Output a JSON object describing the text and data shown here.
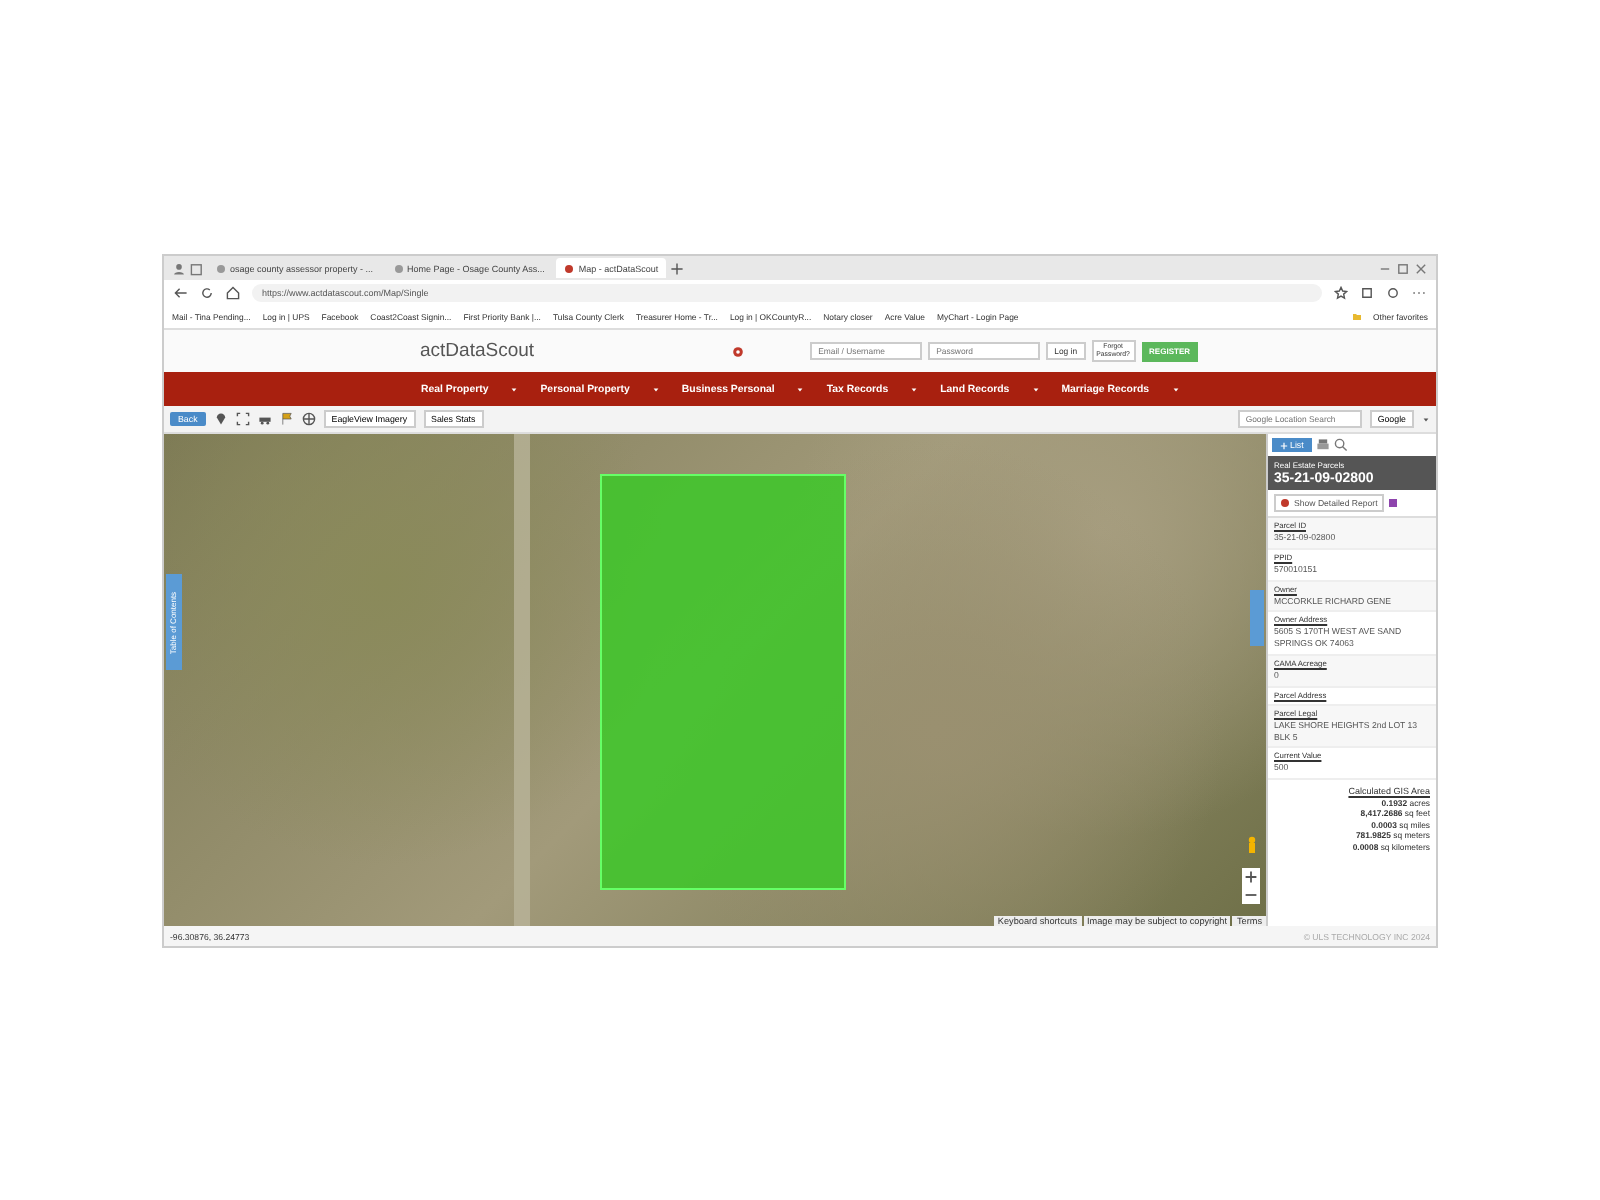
{
  "browser": {
    "tabs": [
      {
        "title": "osage county assessor property - ...",
        "selected": false
      },
      {
        "title": "Home Page - Osage County Ass...",
        "selected": false
      },
      {
        "title": "Map - actDataScout",
        "selected": true
      }
    ],
    "address": "https://www.actdatascout.com/Map/Single",
    "bookmarks": [
      "Mail - Tina Pending...",
      "Log in | UPS",
      "Facebook",
      "Coast2Coast Signin...",
      "First Priority Bank |...",
      "Tulsa County Clerk",
      "Treasurer Home - Tr...",
      "Log in | OKCountyR...",
      "Notary closer",
      "Acre Value",
      "MyChart - Login Page"
    ],
    "other_favorites": "Other favorites"
  },
  "site": {
    "logo": "actDataScout",
    "email_placeholder": "Email / Username",
    "password_placeholder": "Password",
    "login_button": "Log in",
    "forgot_link": "Forgot Password?",
    "register_button": "REGISTER",
    "nav": [
      "Real Property",
      "Personal Property",
      "Business Personal",
      "Tax Records",
      "Land Records",
      "Marriage Records"
    ]
  },
  "toolbar": {
    "back": "Back",
    "eagleview": "EagleView Imagery",
    "sales_stats": "Sales Stats",
    "search_placeholder": "Google Location Search",
    "provider": "Google"
  },
  "map": {
    "side_tab": "Table of Contents",
    "attribution": [
      "Keyboard shortcuts",
      "Image may be subject to copyright",
      "Terms"
    ],
    "coordinates": "-96.30876, 36.24773"
  },
  "panel": {
    "list_button": "List",
    "layer": "Real Estate Parcels",
    "parcel": "35-21-09-02800",
    "report": "Show Detailed Report",
    "fields": [
      {
        "label": "Parcel ID",
        "value": "35-21-09-02800"
      },
      {
        "label": "PPID",
        "value": "570010151"
      },
      {
        "label": "Owner",
        "value": "MCCORKLE RICHARD GENE"
      },
      {
        "label": "Owner Address",
        "value": "5605 S 170TH WEST AVE SAND SPRINGS OK 74063"
      },
      {
        "label": "CAMA Acreage",
        "value": "0"
      },
      {
        "label": "Parcel Address"
      },
      {
        "label": "Parcel Legal",
        "value": "LAKE SHORE HEIGHTS 2nd LOT 13 BLK 5"
      },
      {
        "label": "Current Value",
        "value": "500"
      }
    ],
    "area_title": "Calculated GIS Area",
    "areas": [
      {
        "value": "0.1932",
        "unit": "acres"
      },
      {
        "value": "8,417.2686",
        "unit": "sq feet"
      },
      {
        "value": "0.0003",
        "unit": "sq miles"
      },
      {
        "value": "781.9825",
        "unit": "sq meters"
      },
      {
        "value": "0.0008",
        "unit": "sq kilometers"
      }
    ]
  },
  "footer": "© ULS TECHNOLOGY INC 2024"
}
